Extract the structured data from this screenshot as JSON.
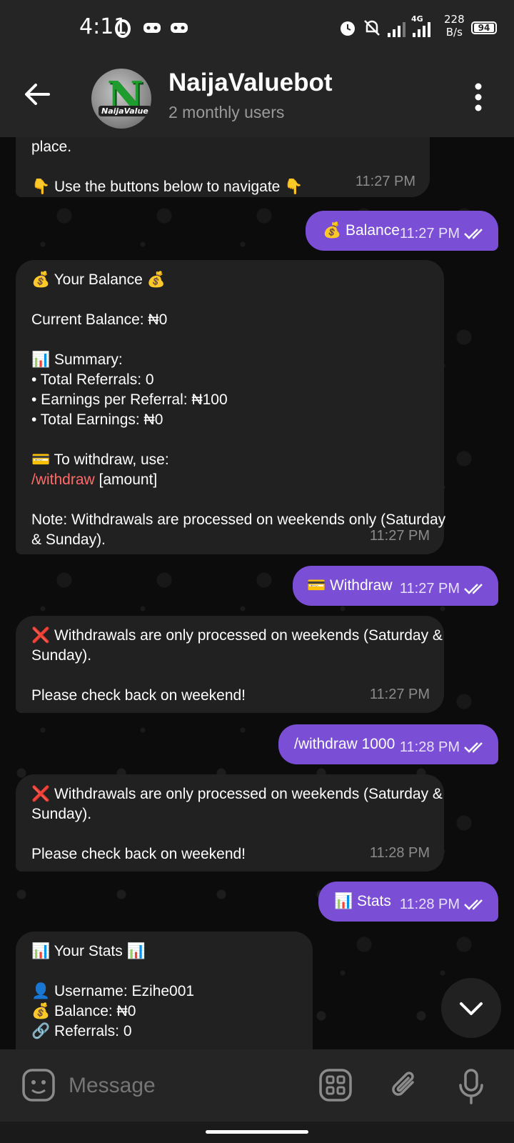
{
  "status_bar": {
    "time": "4:11",
    "network_speed_value": "228",
    "network_speed_unit": "B/s",
    "network_type": "4G",
    "battery": "94"
  },
  "header": {
    "bot_name": "NaijaValuebot",
    "subtitle": "2 monthly users",
    "avatar_letter": "N",
    "avatar_brand": "NaijaValue"
  },
  "messages": {
    "m1": {
      "line1": "place.",
      "line2": "👇 Use the buttons below to navigate 👇",
      "time": "11:27 PM"
    },
    "m2": {
      "text": "💰 Balance",
      "time": "11:27 PM"
    },
    "m3": {
      "title": "💰 Your Balance 💰",
      "current_balance": "Current Balance: ₦0",
      "summary": "📊 Summary:",
      "total_referrals": "• Total Referrals: 0",
      "earnings_per_referral": "• Earnings per Referral: ₦100",
      "total_earnings": "• Total Earnings: ₦0",
      "withdraw_hint": "💳 To withdraw, use:",
      "withdraw_cmd": "/withdraw",
      "withdraw_arg": " [amount]",
      "note1": "Note: Withdrawals are processed on weekends only (Saturday",
      "note2": "& Sunday).",
      "time": "11:27 PM"
    },
    "m4": {
      "text": "💳 Withdraw",
      "time": "11:27 PM"
    },
    "m5": {
      "line1": "❌ Withdrawals are only processed on weekends (Saturday &",
      "line2": "Sunday).",
      "line3": "Please check back on weekend!",
      "time": "11:27 PM"
    },
    "m6": {
      "text": "/withdraw 1000",
      "time": "11:28 PM"
    },
    "m7": {
      "line1": "❌ Withdrawals are only processed on weekends (Saturday &",
      "line2": "Sunday).",
      "line3": "Please check back on weekend!",
      "time": "11:28 PM"
    },
    "m8": {
      "text": "📊 Stats",
      "time": "11:28 PM"
    },
    "m9": {
      "title": "📊 Your Stats 📊",
      "username": "👤 Username: Ezihe001",
      "balance": "💰 Balance: ₦0",
      "referrals": "🔗 Referrals: 0"
    }
  },
  "input": {
    "placeholder": "Message"
  },
  "colors": {
    "outgoing_bubble": "#7a4fd6",
    "incoming_bubble": "#212121",
    "bar": "#252525",
    "command_link": "#ff6b6b"
  }
}
